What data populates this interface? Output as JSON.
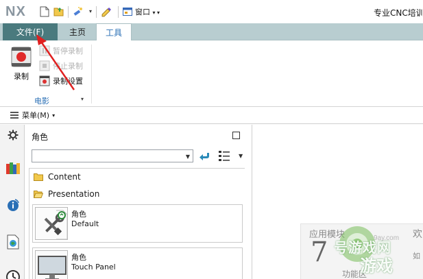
{
  "titlebar": {
    "logo": "NX",
    "window_menu_label": "窗口",
    "title": "专业CNC培训"
  },
  "ribbon_tabs": {
    "file": "文件(F)",
    "home": "主页",
    "tools": "工具"
  },
  "ribbon": {
    "record_label": "录制",
    "pause_record": "暂停录制",
    "stop_record": "停止录制",
    "record_settings": "录制设置",
    "group_label": "电影"
  },
  "menubar": {
    "menu_label": "菜单(M)"
  },
  "roles_panel": {
    "title": "角色",
    "combo_value": "",
    "folders": [
      "Content",
      "Presentation"
    ],
    "roles": [
      {
        "name": "角色",
        "desc": "Default"
      },
      {
        "name": "角色",
        "desc": "Touch Panel"
      }
    ]
  },
  "workarea": {
    "card_title": "应用模块",
    "card_big": "7",
    "card_line": "功能区",
    "card_right": "欢",
    "card_right2": "如"
  },
  "watermark": {
    "url": "9ay.com",
    "brand": "号游戏网",
    "brand2": "游戏"
  },
  "colors": {
    "file_tab_bg": "#4a7a7e",
    "tabbar_bg": "#b8cdd0",
    "accent_blue": "#2a6fb5",
    "arrow_red": "#e02020"
  },
  "icons": {
    "new": "new-file-icon",
    "open": "open-folder-icon",
    "magic": "wand-icon",
    "pencil": "pencil-icon",
    "window": "window-icon"
  }
}
